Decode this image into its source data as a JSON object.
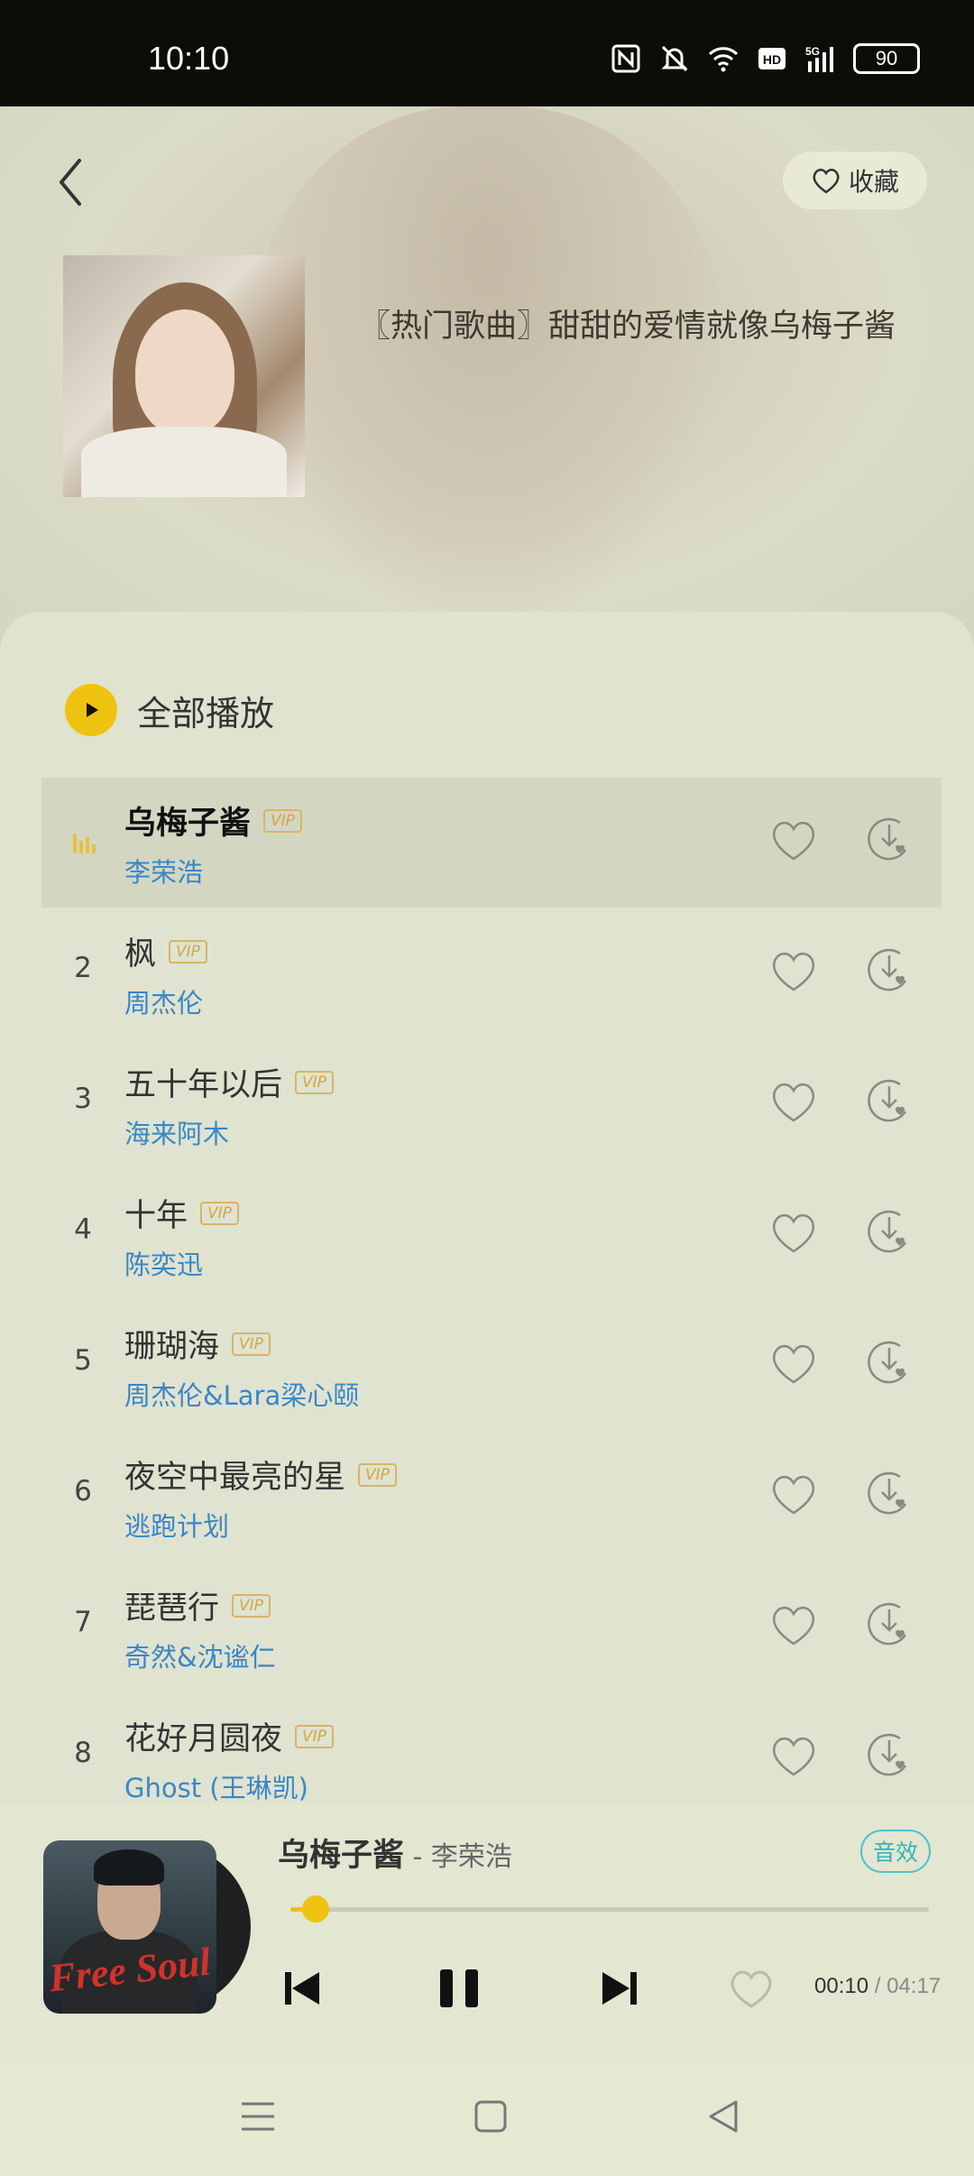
{
  "status_bar": {
    "time": "10:10",
    "battery": "90"
  },
  "header": {
    "fav_label": "收藏",
    "playlist_title": "〖热门歌曲〗甜甜的爱情就像乌梅子酱"
  },
  "play_all_label": "全部播放",
  "vip_label": "VIP",
  "songs": [
    {
      "num": "",
      "title": "乌梅子酱",
      "artist": "李荣浩",
      "playing": true
    },
    {
      "num": "2",
      "title": "枫",
      "artist": "周杰伦"
    },
    {
      "num": "3",
      "title": "五十年以后",
      "artist": "海来阿木"
    },
    {
      "num": "4",
      "title": "十年",
      "artist": "陈奕迅"
    },
    {
      "num": "5",
      "title": "珊瑚海",
      "artist": "周杰伦&Lara梁心颐"
    },
    {
      "num": "6",
      "title": "夜空中最亮的星",
      "artist": "逃跑计划"
    },
    {
      "num": "7",
      "title": "琵琶行",
      "artist": "奇然&沈谧仁"
    },
    {
      "num": "8",
      "title": "花好月圆夜",
      "artist": "Ghost (王琳凯)"
    }
  ],
  "player": {
    "title": "乌梅子酱",
    "artist_sep": " - 李荣浩",
    "sfx_label": "音效",
    "art_text": "Free Soul",
    "current_time": "00:10",
    "time_sep": " / ",
    "duration": "04:17",
    "progress": 0.04
  },
  "colors": {
    "accent": "#eec30f",
    "artist_link": "#3a86c8",
    "sfx": "#2fb4bc"
  }
}
